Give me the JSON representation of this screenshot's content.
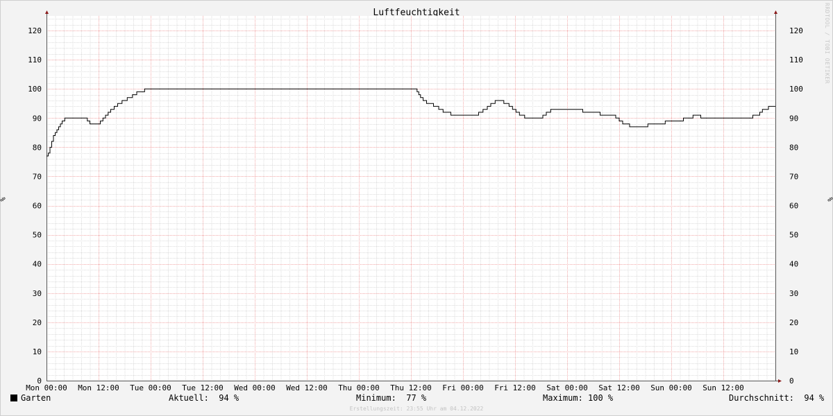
{
  "chart_data": {
    "type": "line",
    "title": "Luftfeuchtigkeit",
    "ylabel": "%",
    "ylim": [
      0,
      125
    ],
    "yticks": [
      0,
      10,
      20,
      30,
      40,
      50,
      60,
      70,
      80,
      90,
      100,
      110,
      120
    ],
    "xlim": [
      0,
      168
    ],
    "xticks": [
      {
        "x": 0,
        "label": "Mon 00:00"
      },
      {
        "x": 12,
        "label": "Mon 12:00"
      },
      {
        "x": 24,
        "label": "Tue 00:00"
      },
      {
        "x": 36,
        "label": "Tue 12:00"
      },
      {
        "x": 48,
        "label": "Wed 00:00"
      },
      {
        "x": 60,
        "label": "Wed 12:00"
      },
      {
        "x": 72,
        "label": "Thu 00:00"
      },
      {
        "x": 84,
        "label": "Thu 12:00"
      },
      {
        "x": 96,
        "label": "Fri 00:00"
      },
      {
        "x": 108,
        "label": "Fri 12:00"
      },
      {
        "x": 120,
        "label": "Sat 00:00"
      },
      {
        "x": 132,
        "label": "Sat 12:00"
      },
      {
        "x": 144,
        "label": "Sun 00:00"
      },
      {
        "x": 156,
        "label": "Sun 12:00"
      }
    ],
    "grid": true,
    "series": [
      {
        "name": "Garten",
        "color": "#000000",
        "points": [
          [
            0,
            77
          ],
          [
            0.4,
            78
          ],
          [
            0.8,
            80
          ],
          [
            1.2,
            82
          ],
          [
            1.6,
            84
          ],
          [
            2,
            85
          ],
          [
            2.4,
            86
          ],
          [
            2.8,
            87
          ],
          [
            3.2,
            88
          ],
          [
            3.6,
            89
          ],
          [
            4.2,
            90
          ],
          [
            9,
            90
          ],
          [
            9.4,
            89
          ],
          [
            10,
            88
          ],
          [
            12,
            88
          ],
          [
            12.4,
            89
          ],
          [
            13,
            90
          ],
          [
            13.6,
            91
          ],
          [
            14.2,
            92
          ],
          [
            14.8,
            93
          ],
          [
            15.6,
            94
          ],
          [
            16.4,
            95
          ],
          [
            17.4,
            96
          ],
          [
            18.6,
            97
          ],
          [
            19.8,
            98
          ],
          [
            20.8,
            99
          ],
          [
            22.6,
            100
          ],
          [
            85,
            100
          ],
          [
            85.4,
            99
          ],
          [
            85.8,
            98
          ],
          [
            86.2,
            97
          ],
          [
            86.8,
            96
          ],
          [
            87.6,
            95
          ],
          [
            89.2,
            94
          ],
          [
            90.4,
            93
          ],
          [
            91.4,
            92
          ],
          [
            93.2,
            91
          ],
          [
            99.4,
            91
          ],
          [
            99.6,
            92
          ],
          [
            100.6,
            93
          ],
          [
            101.6,
            94
          ],
          [
            102.4,
            95
          ],
          [
            103.4,
            96
          ],
          [
            105.4,
            95
          ],
          [
            106.6,
            94
          ],
          [
            107.4,
            93
          ],
          [
            108.2,
            92
          ],
          [
            109,
            91
          ],
          [
            110.2,
            90
          ],
          [
            114.2,
            90
          ],
          [
            114.4,
            91
          ],
          [
            115.2,
            92
          ],
          [
            116.2,
            93
          ],
          [
            123.4,
            93
          ],
          [
            123.6,
            92
          ],
          [
            127.4,
            92
          ],
          [
            127.6,
            91
          ],
          [
            130.6,
            91
          ],
          [
            131.2,
            90
          ],
          [
            132,
            89
          ],
          [
            132.8,
            88
          ],
          [
            134.4,
            87
          ],
          [
            138.4,
            87
          ],
          [
            138.6,
            88
          ],
          [
            142.4,
            88
          ],
          [
            142.6,
            89
          ],
          [
            146.6,
            89
          ],
          [
            146.8,
            90
          ],
          [
            148.8,
            90
          ],
          [
            149,
            91
          ],
          [
            150.6,
            91
          ],
          [
            150.8,
            90
          ],
          [
            162.4,
            90
          ],
          [
            162.8,
            91
          ],
          [
            164.2,
            91
          ],
          [
            164.4,
            92
          ],
          [
            165,
            93
          ],
          [
            166.2,
            93
          ],
          [
            166.4,
            94
          ],
          [
            168,
            94
          ]
        ]
      }
    ]
  },
  "legend": {
    "series_name": "Garten",
    "aktuell": "Aktuell:  94 %",
    "minimum": "Minimum:  77 %",
    "maximum": "Maximum: 100 %",
    "durchschnitt": "Durchschnitt:  94 %"
  },
  "watermark": "RRDTOOL / TOBI OETIKER",
  "footer": "Erstellungszeit: 23:55 Uhr am 04.12.2022"
}
